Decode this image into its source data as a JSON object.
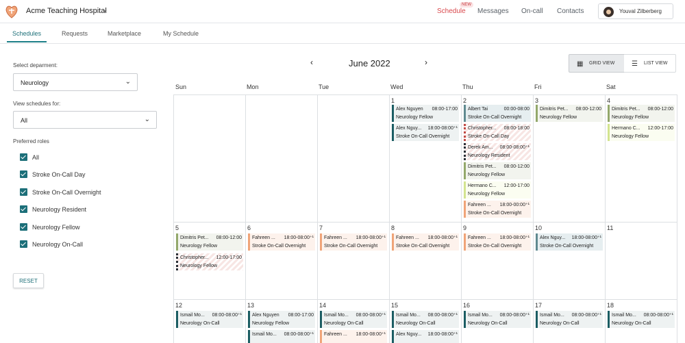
{
  "topbar": {
    "hospital_name": "Acme Teaching Hospital",
    "nav": [
      {
        "label": "Schedule",
        "active": true
      },
      {
        "label": "Messages"
      },
      {
        "label": "On-call"
      },
      {
        "label": "Contacts"
      }
    ],
    "new_badge": "NEW",
    "user_name": "Youval Zilberberg"
  },
  "subtabs": [
    "Schedules",
    "Requests",
    "Marketplace",
    "My Schedule"
  ],
  "filters": {
    "department_label": "Select deparment:",
    "department_value": "Neurology",
    "view_for_label": "View schedules for:",
    "view_for_value": "All",
    "roles_label": "Preferred roles",
    "roles": [
      "All",
      "Stroke On-Call Day",
      "Stroke On-Call Overnight",
      "Neurology Resident",
      "Neurology Fellow",
      "Neurology On-Call"
    ],
    "reset_label": "RESET"
  },
  "calendar": {
    "month": "June 2022",
    "grid_view_label": "GRID VIEW",
    "list_view_label": "LIST VIEW",
    "days_of_week": [
      "Sun",
      "Mon",
      "Tue",
      "Wed",
      "Thu",
      "Fri",
      "Sat"
    ],
    "day_numbers": [
      "1",
      "2",
      "3",
      "4",
      "5",
      "6",
      "7",
      "8",
      "9",
      "10",
      "11",
      "12",
      "13",
      "14",
      "15",
      "16",
      "17",
      "18"
    ],
    "events": [
      {
        "name": "Alex Nguyen",
        "time": "08:00-17:00",
        "role": "Neurology Fellow"
      },
      {
        "name": "Alex Nguy...",
        "time": "18:00-08:00⁺¹",
        "role": "Stroke On-Call Overnight"
      },
      {
        "name": "Albert Tai",
        "time": "00:00-08:00",
        "role": "Stroke On-Call Overnight"
      },
      {
        "name": "Christopher...",
        "time": "08:00-18:00",
        "role": "Stroke On-Call Day"
      },
      {
        "name": "Derek Am...",
        "time": "08:00-08:00⁺¹",
        "role": "Neurology Resident"
      },
      {
        "name": "Dimitris Pet...",
        "time": "08:00-12:00",
        "role": "Neurology Fellow"
      },
      {
        "name": "Hermano C...",
        "time": "12:00-17:00",
        "role": "Neurology Fellow"
      },
      {
        "name": "Fahreen ...",
        "time": "18:00-00:00⁺¹",
        "role": "Stroke On-Call Overnight"
      },
      {
        "name": "Dimitris Pet...",
        "time": "08:00-12:00",
        "role": "Neurology Fellow"
      },
      {
        "name": "Dimitris Pet...",
        "time": "08:00-12:00",
        "role": "Neurology Fellow"
      },
      {
        "name": "Hermano C...",
        "time": "12:00-17:00",
        "role": "Neurology Fellow"
      },
      {
        "name": "Dimitris Pet...",
        "time": "08:00-12:00",
        "role": "Neurology Fellow"
      },
      {
        "name": "Christopher...",
        "time": "12:00-17:00",
        "role": "Neurology Fellow"
      },
      {
        "name": "Fahreen ...",
        "time": "18:00-08:00⁺¹",
        "role": "Stroke On-Call Overnight"
      },
      {
        "name": "Fahreen ...",
        "time": "18:00-08:00⁺¹",
        "role": "Stroke On-Call Overnight"
      },
      {
        "name": "Fahreen ...",
        "time": "18:00-08:00⁺¹",
        "role": "Stroke On-Call Overnight"
      },
      {
        "name": "Fahreen ...",
        "time": "18:00-08:00⁺¹",
        "role": "Stroke On-Call Overnight"
      },
      {
        "name": "Alex Nguy...",
        "time": "18:00-08:00⁺¹",
        "role": "Stroke On-Call Overnight"
      },
      {
        "name": "Ismail Mo...",
        "time": "08:00-08:00⁺¹",
        "role": "Neurology On-Call"
      },
      {
        "name": "Alex Nguyen",
        "time": "08:00-17:00",
        "role": "Neurology Fellow"
      },
      {
        "name": "Ismail Mo...",
        "time": "08:00-08:00⁺¹",
        "role": "Neurology On-Call"
      },
      {
        "name": "Ismail Mo...",
        "time": "08:00-08:00⁺¹",
        "role": "Neurology On-Call"
      },
      {
        "name": "Ismail Mo...",
        "time": "08:00-08:00⁺¹",
        "role": "Neurology On-Call"
      },
      {
        "name": "Ismail Mo...",
        "time": "08:00-08:00⁺¹",
        "role": "Neurology On-Call"
      },
      {
        "name": "Ismail Mo...",
        "time": "08:00-08:00⁺¹",
        "role": "Neurology On-Call"
      },
      {
        "name": "Ismail Mo...",
        "time": "08:00-08:00⁺¹",
        "role": ""
      },
      {
        "name": "Fahreen ...",
        "time": "18:00-08:00⁺¹",
        "role": ""
      },
      {
        "name": "Alex Nguy...",
        "time": "18:00-08:00⁺¹",
        "role": ""
      }
    ]
  },
  "colors": {
    "accent": "#1d6f78",
    "schedule_active": "#d9484c"
  }
}
